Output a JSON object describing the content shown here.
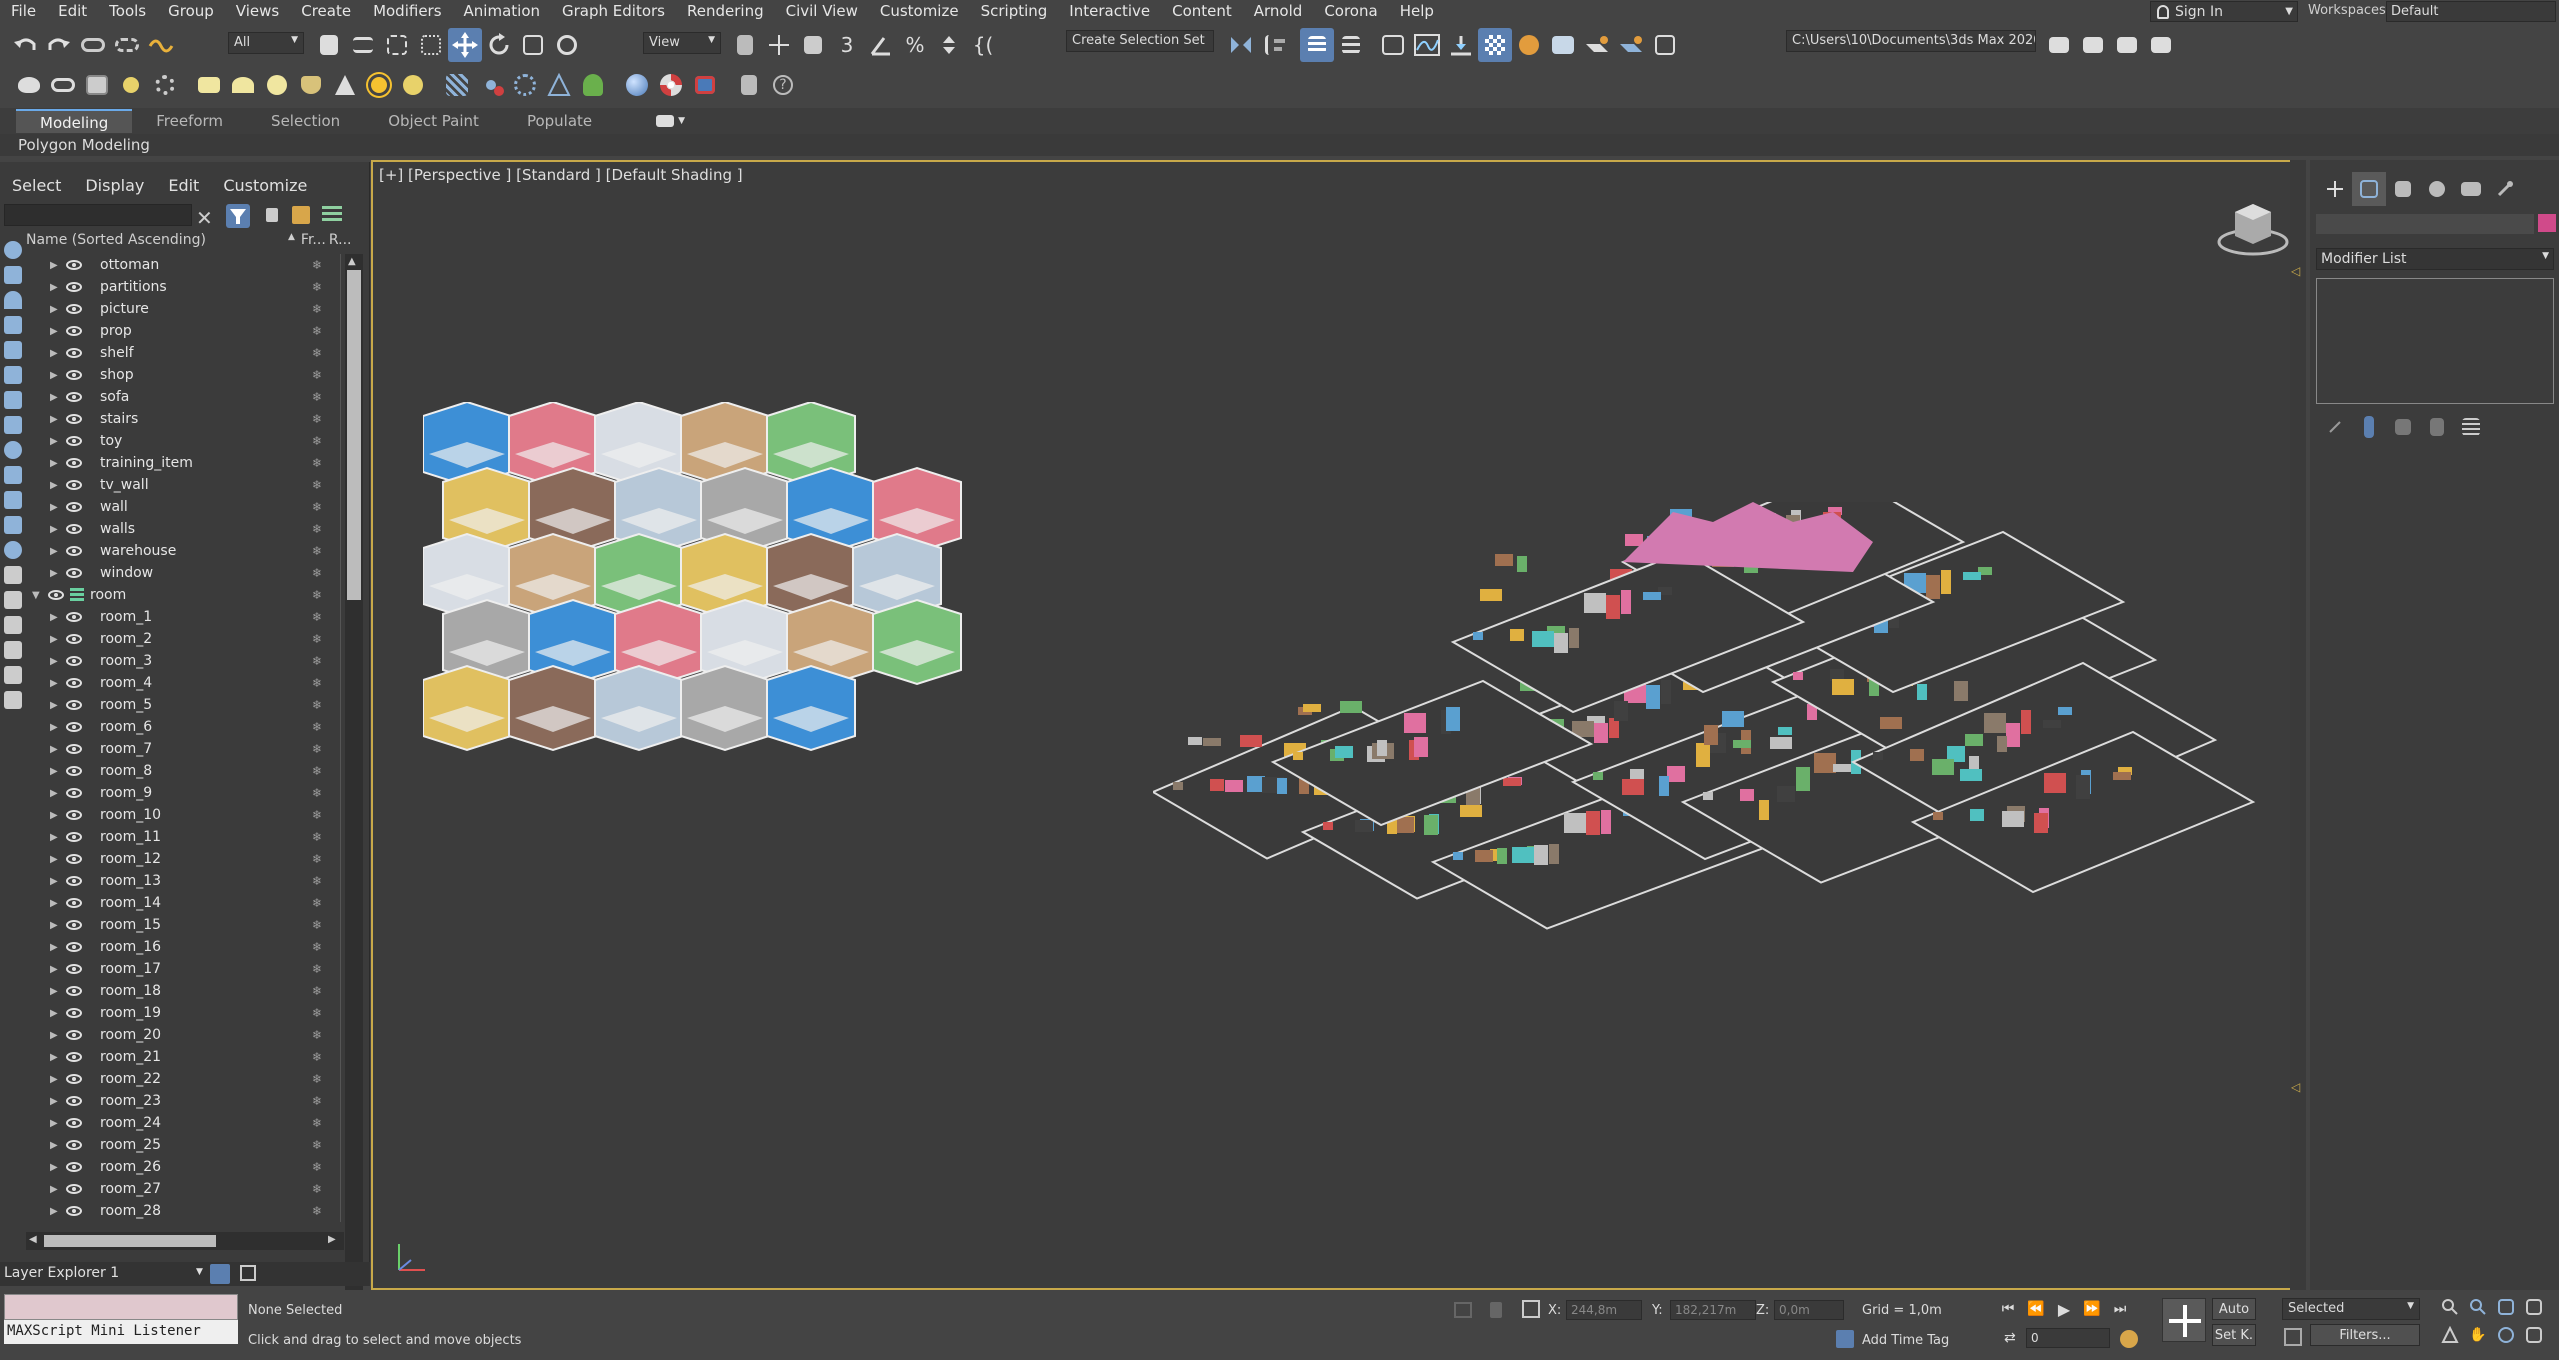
{
  "menu": [
    "File",
    "Edit",
    "Tools",
    "Group",
    "Views",
    "Create",
    "Modifiers",
    "Animation",
    "Graph Editors",
    "Rendering",
    "Civil View",
    "Customize",
    "Scripting",
    "Interactive",
    "Content",
    "Arnold",
    "Corona",
    "Help"
  ],
  "account": {
    "sign_in": "Sign In",
    "workspaces_label": "Workspaces:",
    "workspace": "Default"
  },
  "toolbar": {
    "filter": "All",
    "ref_coord": "View",
    "selection_set": "Create Selection Set",
    "project_path": "C:\\Users\\10\\Documents\\3ds Max 2020"
  },
  "ribbon": {
    "tabs": [
      "Modeling",
      "Freeform",
      "Selection",
      "Object Paint",
      "Populate"
    ],
    "active": "Modeling",
    "panel": "Polygon Modeling"
  },
  "explorer": {
    "menu": [
      "Select",
      "Display",
      "Edit",
      "Customize"
    ],
    "col_name": "Name (Sorted Ascending)",
    "col_frozen": "Fr...",
    "col_render": "R...",
    "items": [
      "ottoman",
      "partitions",
      "picture",
      "prop",
      "shelf",
      "shop",
      "sofa",
      "stairs",
      "toy",
      "training_item",
      "tv_wall",
      "wall",
      "walls",
      "warehouse",
      "window"
    ],
    "group": "room",
    "rooms": [
      "room_1",
      "room_2",
      "room_3",
      "room_4",
      "room_5",
      "room_6",
      "room_7",
      "room_8",
      "room_9",
      "room_10",
      "room_11",
      "room_12",
      "room_13",
      "room_14",
      "room_15",
      "room_16",
      "room_17",
      "room_18",
      "room_19",
      "room_20",
      "room_21",
      "room_22",
      "room_23",
      "room_24",
      "room_25",
      "room_26",
      "room_27",
      "room_28"
    ],
    "layer_explorer": "Layer Explorer 1"
  },
  "viewport": {
    "label": "[+] [Perspective ] [Standard ] [Default Shading ]"
  },
  "command_panel": {
    "modifier_list": "Modifier List",
    "swatch_color": "#d04a8a"
  },
  "status": {
    "maxscript": "MAXScript Mini Listener",
    "selection": "None Selected",
    "prompt": "Click and drag to select and move objects",
    "x_label": "X:",
    "x_value": "244,8m",
    "y_label": "Y:",
    "y_value": "182,217m",
    "z_label": "Z:",
    "z_value": "0,0m",
    "grid": "Grid = 1,0m",
    "add_time_tag": "Add Time Tag",
    "auto": "Auto",
    "set_key": "Set K.",
    "key_filter": "Selected",
    "filters": "Filters...",
    "frame": "0"
  }
}
